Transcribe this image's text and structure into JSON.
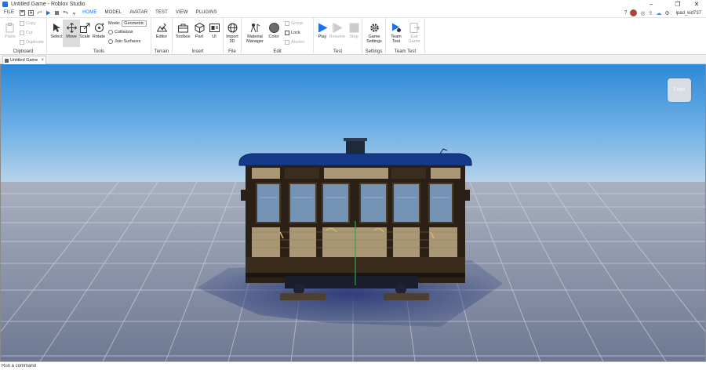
{
  "window": {
    "title": "Untitled Game - Roblox Studio",
    "minimize": "–",
    "maximize": "❐",
    "close": "✕"
  },
  "menubar": {
    "file": "FILE",
    "tabs": [
      "HOME",
      "MODEL",
      "AVATAR",
      "TEST",
      "VIEW",
      "PLUGINS"
    ],
    "active_tab": "HOME",
    "username": "ipad_kid737"
  },
  "ribbon": {
    "clipboard": {
      "label": "Clipboard",
      "paste": "Paste",
      "copy": "Copy",
      "cut": "Cut",
      "duplicate": "Duplicate"
    },
    "tools": {
      "label": "Tools",
      "select": "Select",
      "move": "Move",
      "scale": "Scale",
      "rotate": "Rotate",
      "mode_label": "Mode:",
      "mode_value": "Geometric",
      "collisions": "Collisions",
      "join_surfaces": "Join Surfaces"
    },
    "terrain": {
      "label": "Terrain",
      "editor": "Editor"
    },
    "insert": {
      "label": "Insert",
      "toolbox": "Toolbox",
      "part": "Part",
      "ui": "UI"
    },
    "file": {
      "label": "File",
      "import3d_line1": "Import",
      "import3d_line2": "3D"
    },
    "edit": {
      "label": "Edit",
      "material_line1": "Material",
      "material_line2": "Manager",
      "color": "Color",
      "group": "Group",
      "lock": "Lock",
      "anchor": "Anchor"
    },
    "test": {
      "label": "Test",
      "play": "Play",
      "resume": "Resume",
      "stop": "Stop"
    },
    "settings": {
      "label": "Settings",
      "game_settings_line1": "Game",
      "game_settings_line2": "Settings"
    },
    "team_test": {
      "label": "Team Test",
      "team_test_line1": "Team",
      "team_test_line2": "Test",
      "exit_game_line1": "Exit",
      "exit_game_line2": "Game"
    }
  },
  "doc_tab": {
    "label": "Untitled Game"
  },
  "viewport": {
    "view_cube_label": "Front"
  },
  "command_bar": {
    "placeholder": "Run a command"
  },
  "colors": {
    "accent": "#1a73e8",
    "sky_top": "#2e8ad6",
    "sky_bottom": "#a9cce8",
    "ground": "#8a93a7"
  }
}
